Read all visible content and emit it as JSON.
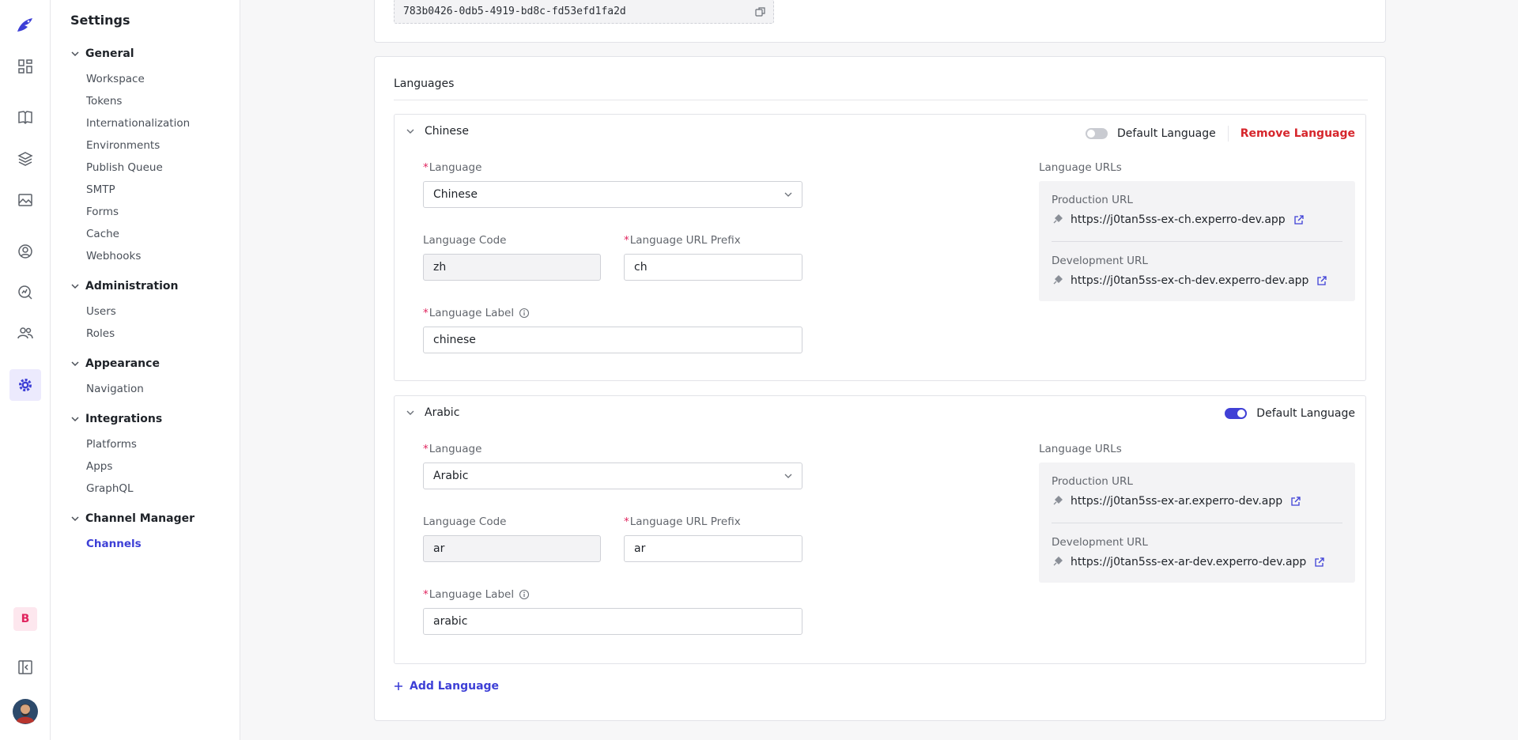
{
  "sidebar": {
    "title": "Settings",
    "groups": [
      {
        "label": "General",
        "items": [
          "Workspace",
          "Tokens",
          "Internationalization",
          "Environments",
          "Publish Queue",
          "SMTP",
          "Forms",
          "Cache",
          "Webhooks"
        ]
      },
      {
        "label": "Administration",
        "items": [
          "Users",
          "Roles"
        ]
      },
      {
        "label": "Appearance",
        "items": [
          "Navigation"
        ]
      },
      {
        "label": "Integrations",
        "items": [
          "Platforms",
          "Apps",
          "GraphQL"
        ]
      },
      {
        "label": "Channel Manager",
        "items": [
          "Channels"
        ]
      }
    ],
    "active_item": "Channels"
  },
  "rail": {
    "badge_letter": "B",
    "accent": "#3d3fd6",
    "icons": [
      "logo-icon",
      "dashboard-icon",
      "book-icon",
      "layers-icon",
      "image-icon",
      "user-circle-icon",
      "analytics-icon",
      "team-icon",
      "settings-icon",
      "collapse-sidebar-icon"
    ]
  },
  "channel": {
    "id": "783b0426-0db5-4919-bd8c-fd53efd1fa2d"
  },
  "languages": {
    "title": "Languages",
    "field_labels": {
      "language": "Language",
      "code": "Language Code",
      "prefix": "Language URL Prefix",
      "label": "Language Label",
      "urls": "Language URLs",
      "production": "Production URL",
      "development": "Development URL"
    },
    "default_label": "Default Language",
    "remove_label": "Remove Language",
    "items": [
      {
        "name": "Chinese",
        "default": false,
        "language": "Chinese",
        "code": "zh",
        "prefix": "ch",
        "label": "chinese",
        "production_url": "https://j0tan5ss-ex-ch.experro-dev.app",
        "development_url": "https://j0tan5ss-ex-ch-dev.experro-dev.app"
      },
      {
        "name": "Arabic",
        "default": true,
        "language": "Arabic",
        "code": "ar",
        "prefix": "ar",
        "label": "arabic",
        "production_url": "https://j0tan5ss-ex-ar.experro-dev.app",
        "development_url": "https://j0tan5ss-ex-ar-dev.experro-dev.app"
      }
    ],
    "add_label": "Add Language"
  }
}
